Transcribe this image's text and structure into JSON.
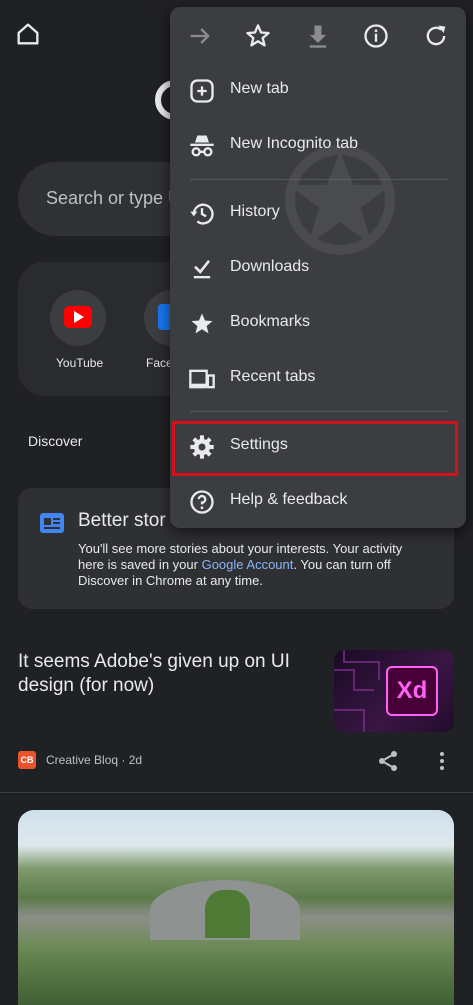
{
  "background_page": {
    "home_icon": "home-icon",
    "search_placeholder": "Search or type U",
    "shortcuts": [
      {
        "label": "YouTube",
        "icon": "youtube-icon"
      },
      {
        "label": "Face",
        "icon": "facebook-icon"
      }
    ],
    "discover_label": "Discover",
    "promo": {
      "title": "Better stor",
      "body_before_link": "You'll see more stories about your interests. Your activity here is saved in your ",
      "link": "Google Account",
      "body_after_link": ". You can turn off Discover in Chrome at any time."
    },
    "article": {
      "title": "It seems Adobe's given up on UI design (for now)",
      "thumb_badge": "Xd",
      "source_badge": "CB",
      "source_meta": "Creative Bloq · 2d"
    }
  },
  "menu": {
    "toolbar": [
      {
        "icon": "forward-icon"
      },
      {
        "icon": "star-icon"
      },
      {
        "icon": "download-icon"
      },
      {
        "icon": "info-icon"
      },
      {
        "icon": "refresh-icon"
      }
    ],
    "items": [
      {
        "label": "New tab",
        "icon": "plus-box-icon"
      },
      {
        "label": "New Incognito tab",
        "icon": "incognito-icon"
      },
      {
        "label": "History",
        "icon": "history-icon"
      },
      {
        "label": "Downloads",
        "icon": "download-check-icon"
      },
      {
        "label": "Bookmarks",
        "icon": "star-filled-icon"
      },
      {
        "label": "Recent tabs",
        "icon": "devices-icon"
      },
      {
        "label": "Settings",
        "icon": "gear-icon",
        "highlighted": true
      },
      {
        "label": "Help & feedback",
        "icon": "help-icon"
      }
    ]
  },
  "colors": {
    "background": "#202124",
    "menu": "#3c3d40",
    "highlight": "#d2121d",
    "link": "#8ab4f8"
  }
}
